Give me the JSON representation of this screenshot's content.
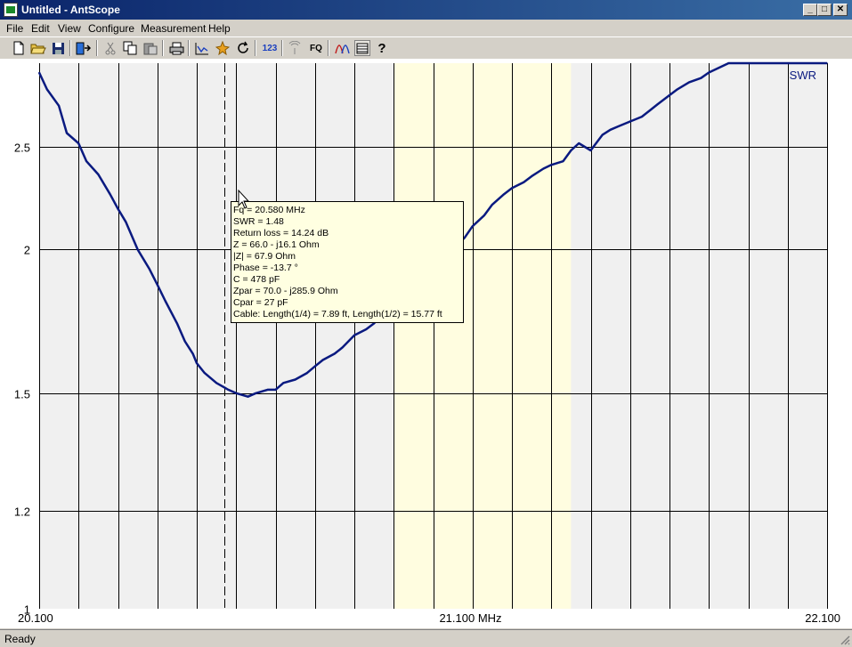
{
  "window": {
    "title": "Untitled - AntScope",
    "minimize": "_",
    "maximize": "□",
    "close": "✕"
  },
  "menu": [
    "File",
    "Edit",
    "View",
    "Configure",
    "Measurement",
    "Help"
  ],
  "toolbar": {
    "icons": [
      "new-file-icon",
      "open-folder-icon",
      "save-disk-icon",
      "export-icon",
      "cut-icon",
      "copy-icon",
      "paste-icon",
      "print-icon",
      "graph-icon",
      "sweep-icon",
      "refresh-icon",
      "numbers-icon",
      "signal-icon",
      "fq-icon",
      "curves-icon",
      "table-icon",
      "help-icon"
    ],
    "numbers_label": "123",
    "fq_label": "FQ",
    "help_label": "?"
  },
  "status": {
    "text": "Ready"
  },
  "tooltip": {
    "lines": [
      "Fq = 20.580 MHz",
      "SWR = 1.48",
      "Return loss = 14.24 dB",
      "Z = 66.0 - j16.1 Ohm",
      "|Z| = 67.9 Ohm",
      "Phase = -13.7 °",
      "C = 478 pF",
      "Zpar = 70.0 - j285.9 Ohm",
      "Cpar = 27 pF",
      "Cable: Length(1/4) = 7.89 ft, Length(1/2) = 15.77 ft"
    ]
  },
  "colors": {
    "curve": "#0a1a80",
    "band_highlight": "#fffde0",
    "plot_background": "#f0f0f0",
    "grid": "#000000",
    "tooltip_background": "#ffffe1"
  },
  "chart_data": {
    "type": "line",
    "title": "",
    "xlabel": "",
    "ylabel": "",
    "series": [
      {
        "name": "SWR",
        "x": [
          20.1,
          20.12,
          20.15,
          20.17,
          20.2,
          20.22,
          20.25,
          20.28,
          20.3,
          20.32,
          20.35,
          20.38,
          20.4,
          20.42,
          20.45,
          20.47,
          20.49,
          20.5,
          20.52,
          20.55,
          20.58,
          20.6,
          20.63,
          20.65,
          20.68,
          20.7,
          20.72,
          20.75,
          20.78,
          20.8,
          20.82,
          20.85,
          20.87,
          20.9,
          20.93,
          20.95,
          20.97,
          21.0,
          21.03,
          21.05,
          21.08,
          21.1,
          21.12,
          21.15,
          21.18,
          21.2,
          21.23,
          21.25,
          21.28,
          21.3,
          21.33,
          21.35,
          21.38,
          21.4,
          21.43,
          21.45,
          21.47,
          21.5,
          21.53,
          21.55,
          21.57,
          21.6,
          21.63,
          21.65,
          21.67,
          21.7,
          21.72,
          21.75,
          21.78,
          21.8,
          21.85,
          21.9,
          22.0,
          22.1
        ],
        "y": [
          2.98,
          2.86,
          2.75,
          2.58,
          2.52,
          2.42,
          2.35,
          2.25,
          2.18,
          2.12,
          2.0,
          1.92,
          1.86,
          1.8,
          1.72,
          1.66,
          1.62,
          1.59,
          1.56,
          1.53,
          1.51,
          1.5,
          1.49,
          1.5,
          1.51,
          1.51,
          1.53,
          1.54,
          1.56,
          1.58,
          1.6,
          1.62,
          1.64,
          1.68,
          1.7,
          1.72,
          1.75,
          1.78,
          1.82,
          1.85,
          1.88,
          1.92,
          1.96,
          2.0,
          2.05,
          2.1,
          2.15,
          2.2,
          2.25,
          2.28,
          2.31,
          2.34,
          2.38,
          2.4,
          2.42,
          2.48,
          2.52,
          2.48,
          2.57,
          2.6,
          2.62,
          2.65,
          2.68,
          2.72,
          2.76,
          2.82,
          2.86,
          2.91,
          2.94,
          2.98,
          3.05,
          3.05,
          3.05,
          3.05
        ]
      }
    ],
    "x_range": [
      20.1,
      22.1
    ],
    "x_scale": "linear",
    "x_ticks": [
      {
        "value": 20.1,
        "label": "20.100"
      },
      {
        "value": 21.1,
        "label": "21.100 MHz"
      },
      {
        "value": 22.1,
        "label": "22.100"
      }
    ],
    "y_range": [
      1,
      3.05
    ],
    "y_scale": "swr",
    "y_ticks": [
      {
        "value": 1,
        "label": "1"
      },
      {
        "value": 1.2,
        "label": "1.2"
      },
      {
        "value": 1.5,
        "label": "1.5"
      },
      {
        "value": 2,
        "label": "2"
      },
      {
        "value": 2.5,
        "label": "2.5"
      }
    ],
    "x_grid_step": 0.1,
    "highlight_band": [
      21.0,
      21.45
    ],
    "cursor_x": 20.58,
    "legend": "top-right",
    "grid": true
  }
}
